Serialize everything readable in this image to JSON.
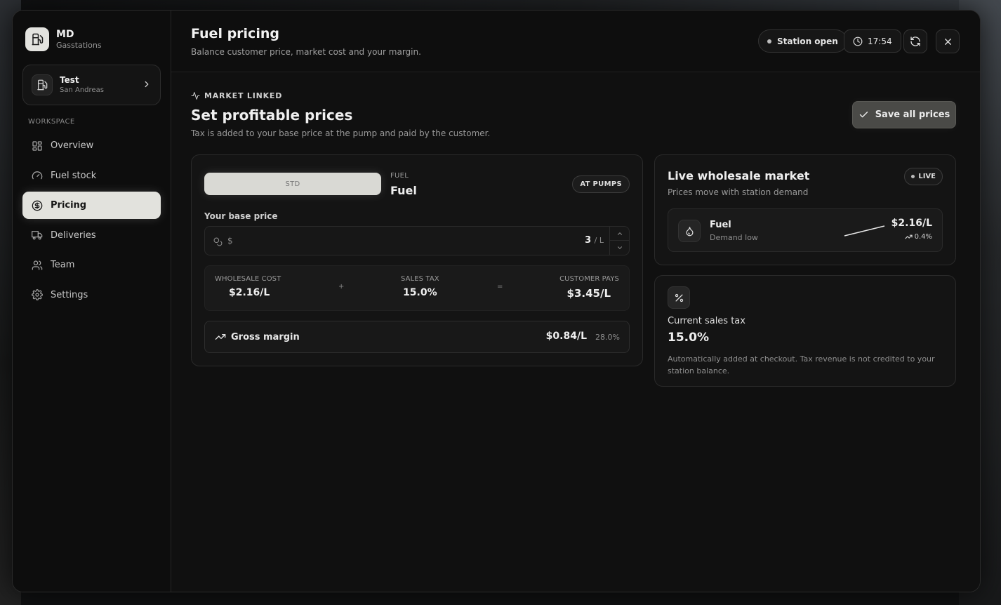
{
  "brand": {
    "name": "MD",
    "sub": "Gasstations"
  },
  "station": {
    "name": "Test",
    "location": "San Andreas"
  },
  "sidebar": {
    "section": "WORKSPACE",
    "items": [
      {
        "label": "Overview",
        "icon": "grid-icon"
      },
      {
        "label": "Fuel stock",
        "icon": "gauge-icon"
      },
      {
        "label": "Pricing",
        "icon": "dollar-circle-icon",
        "active": true
      },
      {
        "label": "Deliveries",
        "icon": "truck-icon"
      },
      {
        "label": "Team",
        "icon": "users-icon"
      },
      {
        "label": "Settings",
        "icon": "gear-icon"
      }
    ]
  },
  "header": {
    "title": "Fuel pricing",
    "subtitle": "Balance customer price, market cost and your margin.",
    "status": "Station open",
    "time": "17:54"
  },
  "section": {
    "eyebrow": "MARKET LINKED",
    "title": "Set profitable prices",
    "subtitle": "Tax is added to your base price at the pump and paid by the customer.",
    "save_label": "Save all prices"
  },
  "pricing_card": {
    "grade_chip": "STD",
    "fuel_label": "FUEL",
    "fuel_name": "Fuel",
    "badge": "AT PUMPS",
    "base_price_label": "Your base price",
    "currency": "$",
    "base_price_value": "3",
    "base_price_unit": "/ L",
    "wholesale_label": "WHOLESALE COST",
    "wholesale_value": "$2.16/L",
    "plus": "+",
    "tax_label": "SALES TAX",
    "tax_value": "15.0%",
    "equals": "=",
    "customer_label": "CUSTOMER PAYS",
    "customer_value": "$3.45/L",
    "margin_label": "Gross margin",
    "margin_value": "$0.84/L",
    "margin_pct": "28.0%"
  },
  "market_card": {
    "title": "Live wholesale market",
    "subtitle": "Prices move with station demand",
    "live": "LIVE",
    "row": {
      "name": "Fuel",
      "demand": "Demand low",
      "price": "$2.16/L",
      "change": "0.4%"
    }
  },
  "tax_card": {
    "title": "Current sales tax",
    "value": "15.0%",
    "note": "Automatically added at checkout. Tax revenue is not credited to your station balance."
  }
}
